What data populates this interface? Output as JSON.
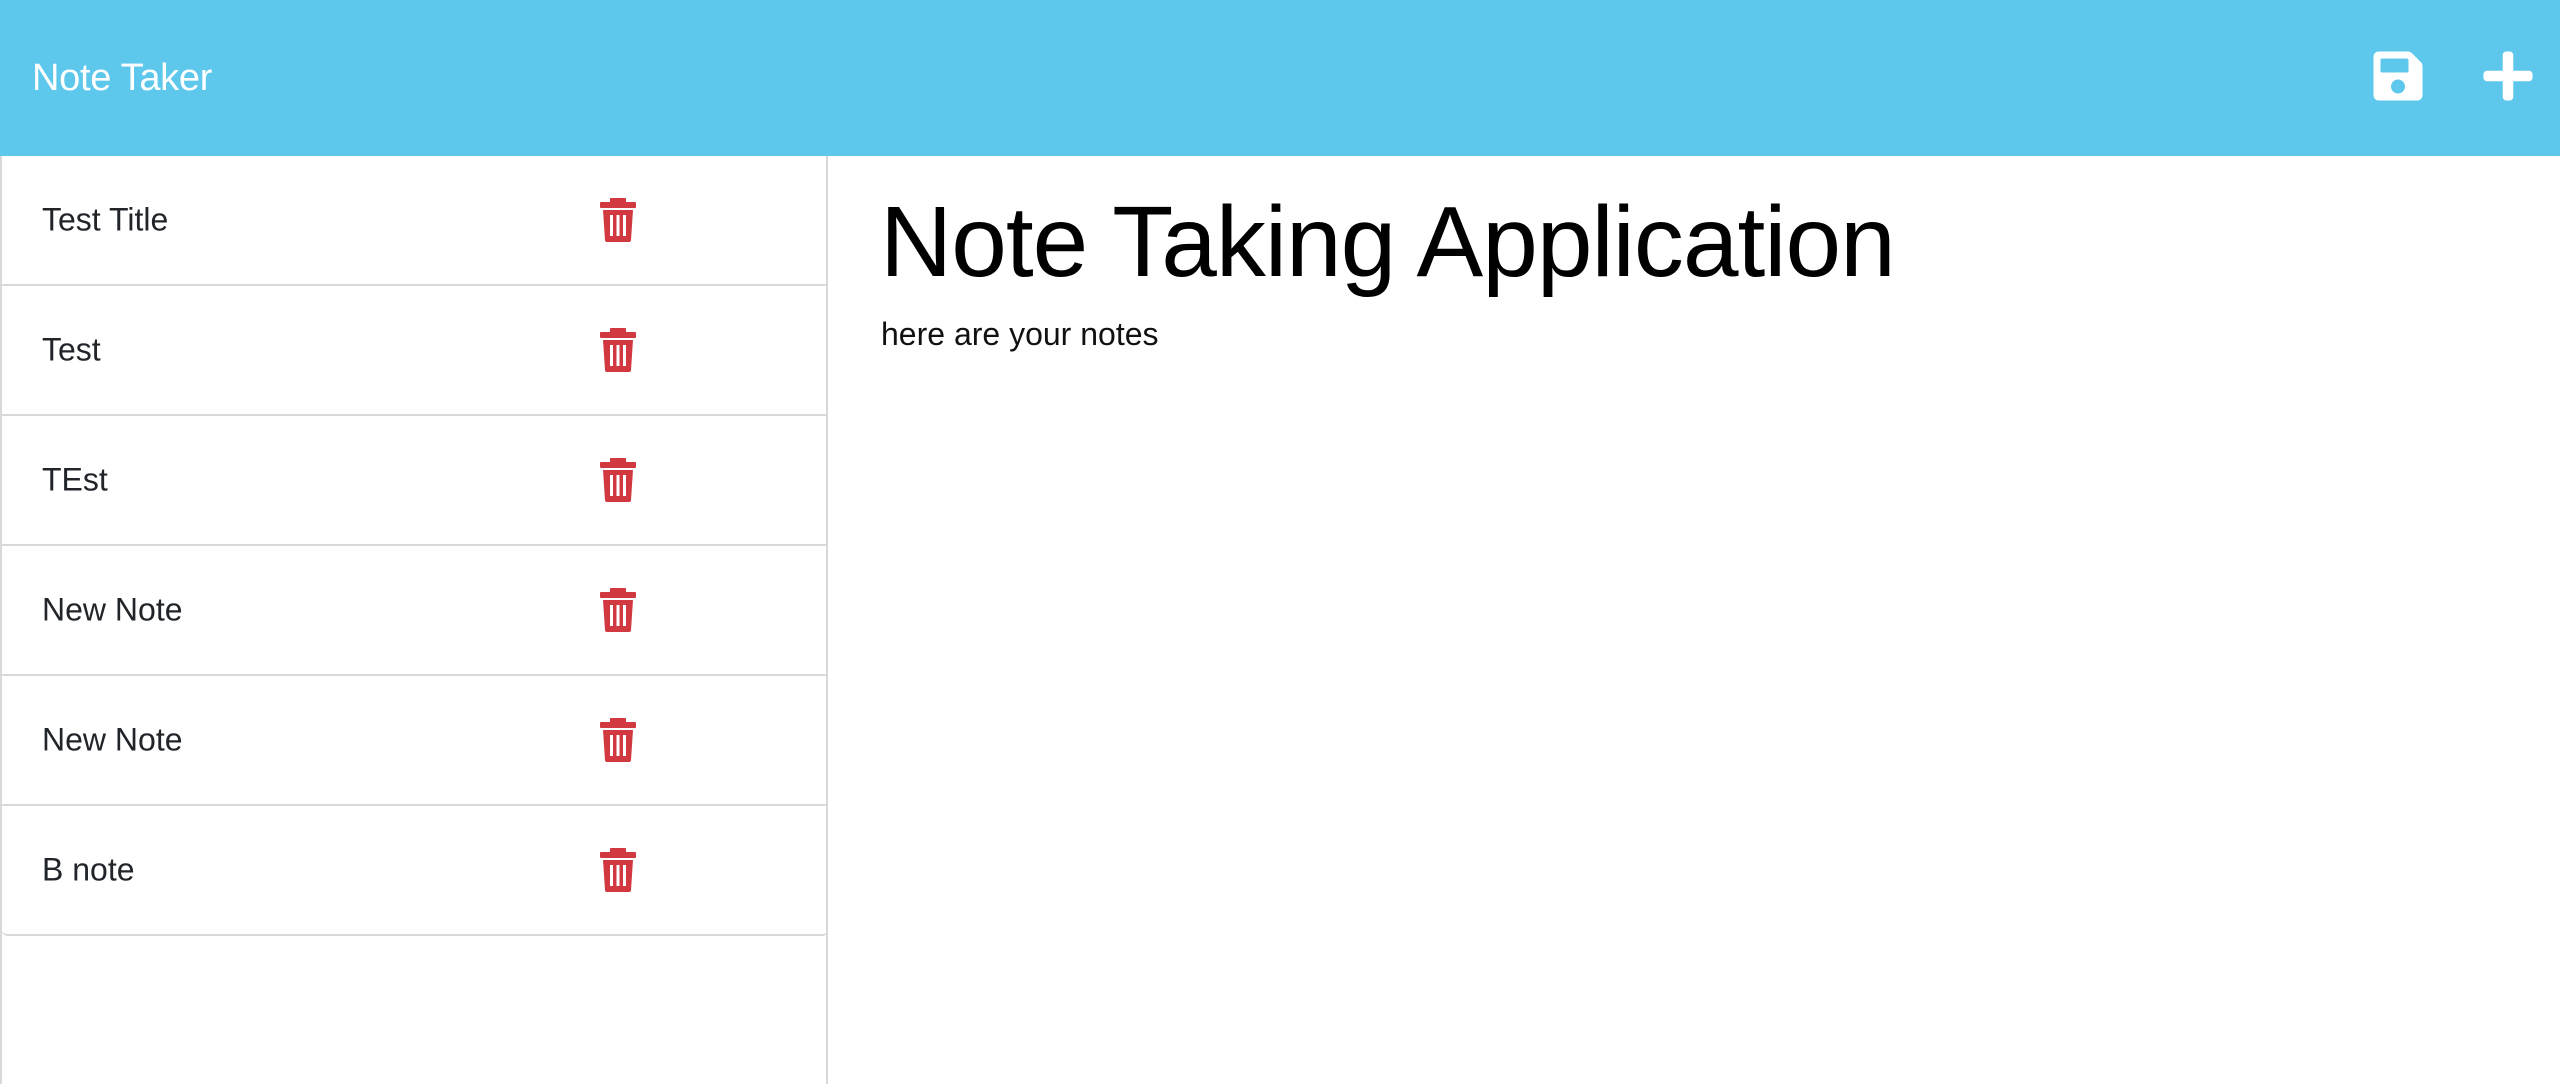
{
  "navbar": {
    "brand": "Note Taker",
    "background": "#5ec8ec",
    "icons": [
      "save-icon",
      "plus-icon"
    ]
  },
  "sidebar": {
    "notes": [
      {
        "title": "Test Title",
        "icon": "trash-icon"
      },
      {
        "title": "Test",
        "icon": "trash-icon"
      },
      {
        "title": "TEst",
        "icon": "trash-icon"
      },
      {
        "title": "New Note",
        "icon": "trash-icon"
      },
      {
        "title": "New Note",
        "icon": "trash-icon"
      },
      {
        "title": "B note",
        "icon": "trash-icon"
      }
    ],
    "delete_color": "#d1383f"
  },
  "main": {
    "title": "Note Taking Application",
    "text": "here are your notes"
  }
}
